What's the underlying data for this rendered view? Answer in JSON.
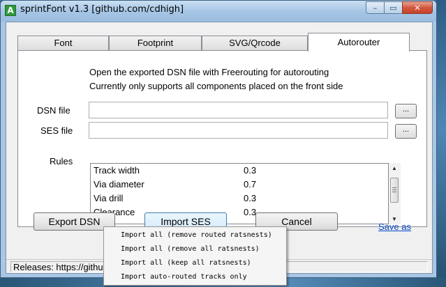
{
  "window": {
    "title": "sprintFont v1.3 [github.com/cdhigh]",
    "icon_letter": "A",
    "app_icon": "app-logo-icon",
    "caption": {
      "minimize": "–",
      "maximize": "▭",
      "close": "✕"
    }
  },
  "tabs": [
    {
      "label": "Font",
      "active": false
    },
    {
      "label": "Footprint",
      "active": false
    },
    {
      "label": "SVG/Qrcode",
      "active": false
    },
    {
      "label": "Autorouter",
      "active": true
    }
  ],
  "autorouter": {
    "info_line1": "Open the exported DSN file with Freerouting for autorouting",
    "info_line2": "Currently only supports all components placed on the front side",
    "dsn_label": "DSN file",
    "dsn_value": "",
    "ses_label": "SES file",
    "ses_value": "",
    "browse_label": "...",
    "rules_label": "Rules",
    "rules": [
      {
        "name": "Track width",
        "value": "0.3"
      },
      {
        "name": "Via diameter",
        "value": "0.7"
      },
      {
        "name": "Via drill",
        "value": "0.3"
      },
      {
        "name": "Clearance",
        "value": "0.3"
      }
    ],
    "export_button": "Export DSN",
    "import_button": "Import SES",
    "cancel_button": "Cancel",
    "save_as_link": "Save as"
  },
  "status_bar": {
    "text": "Releases: https://github"
  },
  "import_menu": {
    "items": [
      "Import all (remove routed ratsnests)",
      "Import all (remove all ratsnests)",
      "Import all (keep all ratsnests)",
      "Import auto-routed tracks only"
    ]
  }
}
